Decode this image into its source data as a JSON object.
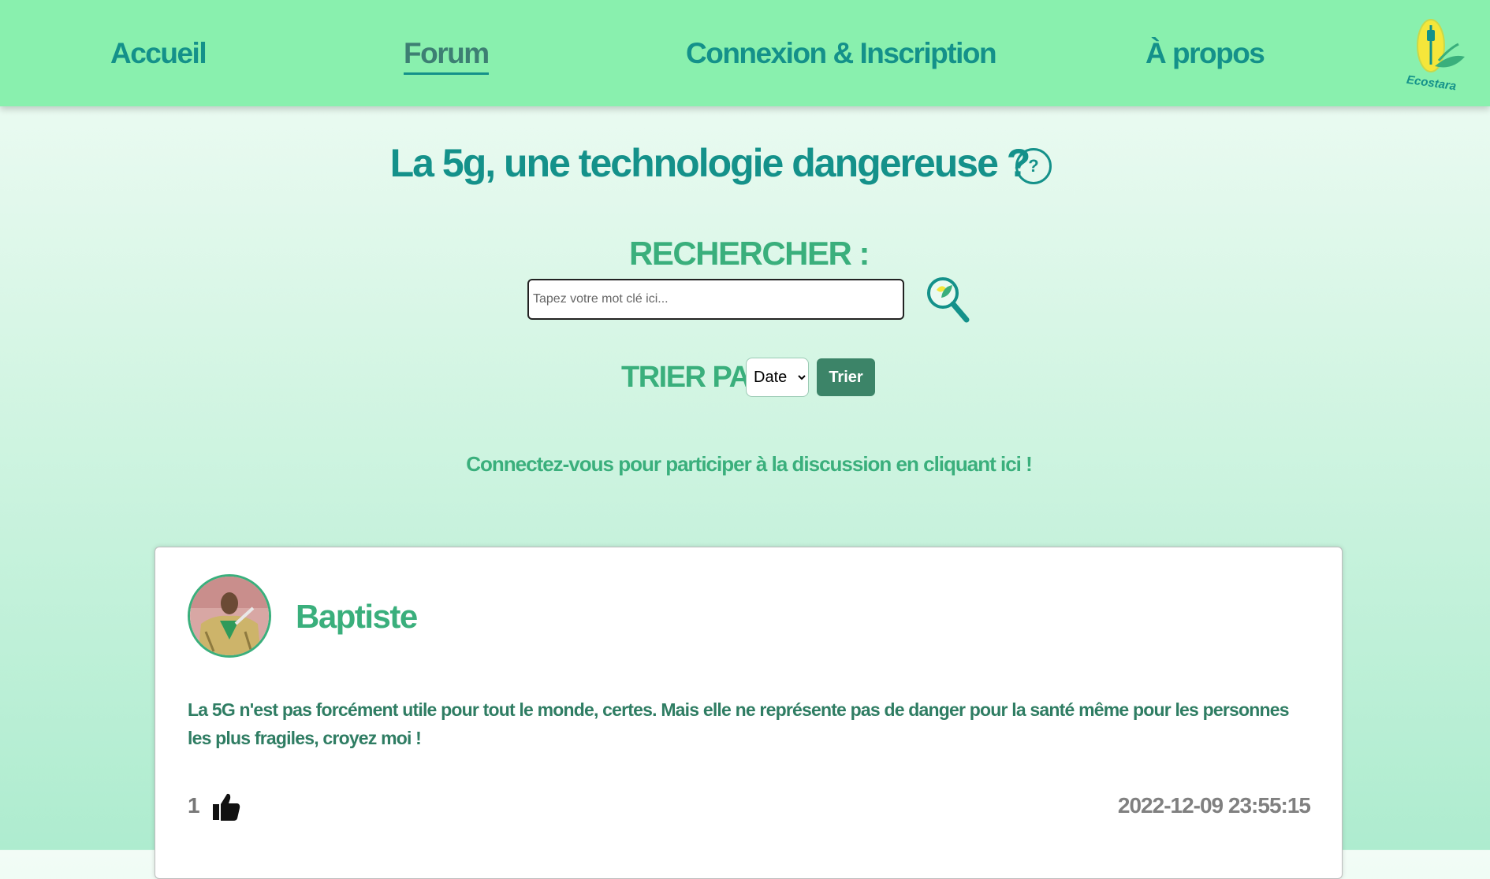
{
  "nav": {
    "items": [
      {
        "label": "Accueil"
      },
      {
        "label": "Forum"
      },
      {
        "label": "Connexion & Inscription"
      },
      {
        "label": "À propos"
      }
    ],
    "active": "Forum",
    "logo_text": "Ecostara"
  },
  "page": {
    "title": "La 5g, une technologie dangereuse ?",
    "help_label": "?"
  },
  "search": {
    "label": "RECHERCHER :",
    "placeholder": "Tapez votre mot clé ici...",
    "value": "",
    "button_icon": "magnifier-leaf-icon"
  },
  "sort": {
    "label": "TRIER PAR :",
    "selected": "Date",
    "button_label": "Trier"
  },
  "connect_prompt": "Connectez-vous pour participer à la discussion en cliquant ici !",
  "post": {
    "author": "Baptiste",
    "text": "La 5G n'est pas forcément utile pour tout le monde, certes. Mais elle ne représente pas de danger pour la santé même pour les personnes les plus fragiles, croyez moi !",
    "likes": "1",
    "like_icon": "thumbs-up-icon",
    "date": "2022-12-09 23:55:15"
  },
  "colors": {
    "navbar": "#89f0ae",
    "teal": "#14918a",
    "green": "#3aaf7c",
    "button": "#3c8468"
  }
}
